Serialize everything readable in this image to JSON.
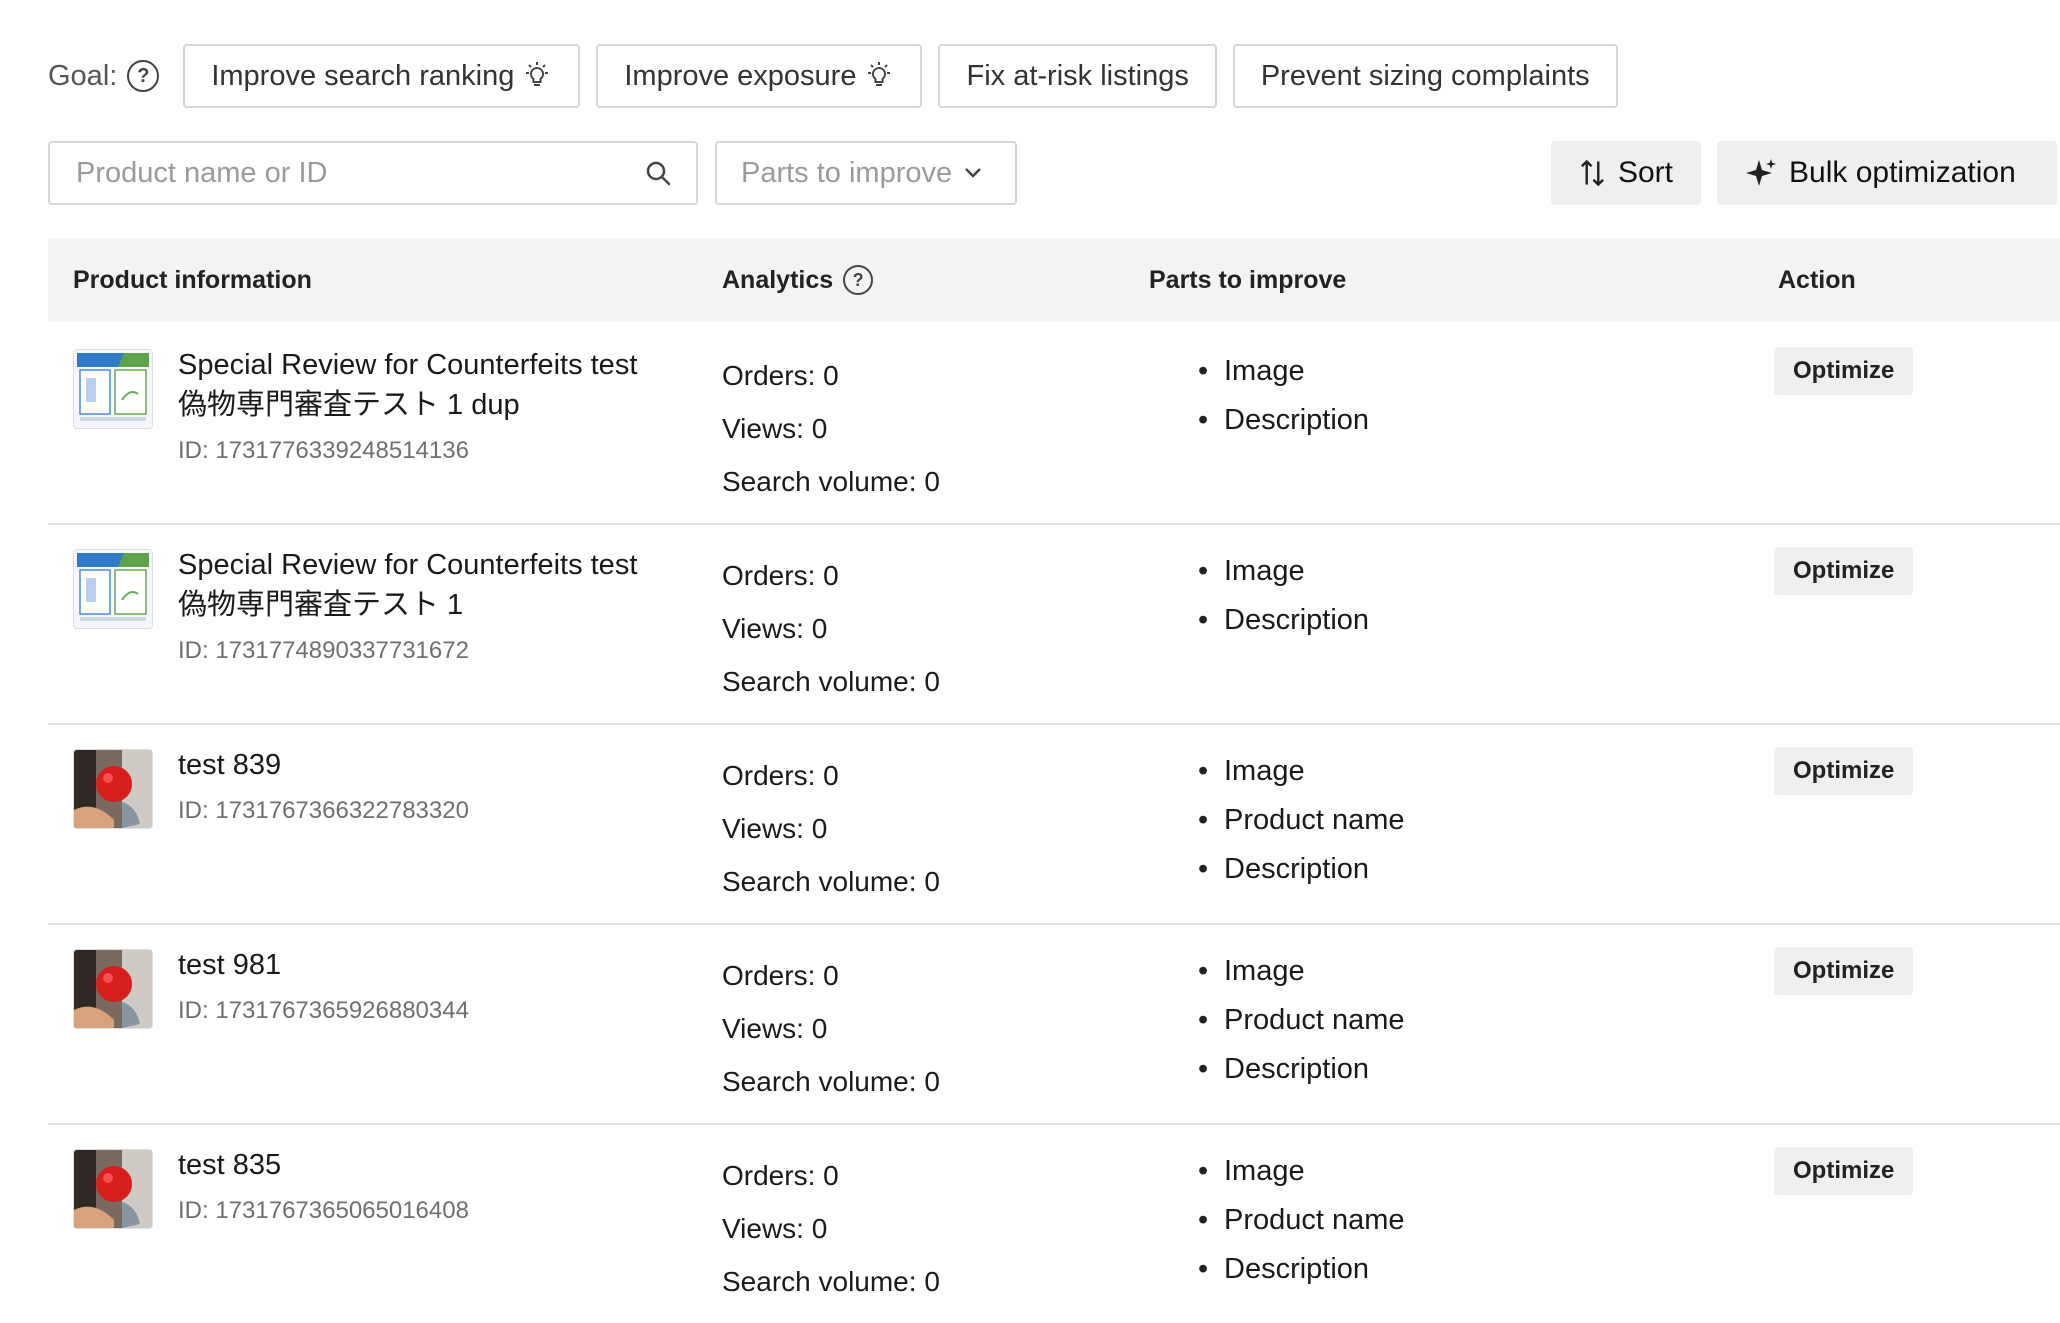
{
  "goal": {
    "label": "Goal:",
    "chips": [
      "Improve search ranking",
      "Improve exposure",
      "Fix at-risk listings",
      "Prevent sizing complaints"
    ]
  },
  "toolbar": {
    "search_placeholder": "Product name or ID",
    "parts_select_placeholder": "Parts to improve",
    "sort_label": "Sort",
    "bulk_label": "Bulk optimization"
  },
  "table": {
    "headers": {
      "product": "Product information",
      "analytics": "Analytics",
      "parts": "Parts to improve",
      "action": "Action"
    },
    "rows": [
      {
        "name_line1": "Special Review for Counterfeits test",
        "name_line2": "偽物専門審査テスト 1 dup",
        "id": "ID: 1731776339248514136",
        "thumb": "poster-icon",
        "orders": "Orders: 0",
        "views": "Views: 0",
        "search_volume": "Search volume: 0",
        "parts": [
          "Image",
          "Description"
        ],
        "action": "Optimize"
      },
      {
        "name_line1": "Special Review for Counterfeits test",
        "name_line2": "偽物専門審査テスト 1",
        "id": "ID: 1731774890337731672",
        "thumb": "poster-icon",
        "orders": "Orders: 0",
        "views": "Views: 0",
        "search_volume": "Search volume: 0",
        "parts": [
          "Image",
          "Description"
        ],
        "action": "Optimize"
      },
      {
        "name_line1": "test 839",
        "name_line2": "",
        "id": "ID: 1731767366322783320",
        "thumb": "apple-photo",
        "orders": "Orders: 0",
        "views": "Views: 0",
        "search_volume": "Search volume: 0",
        "parts": [
          "Image",
          "Product name",
          "Description"
        ],
        "action": "Optimize"
      },
      {
        "name_line1": "test 981",
        "name_line2": "",
        "id": "ID: 1731767365926880344",
        "thumb": "apple-photo",
        "orders": "Orders: 0",
        "views": "Views: 0",
        "search_volume": "Search volume: 0",
        "parts": [
          "Image",
          "Product name",
          "Description"
        ],
        "action": "Optimize"
      },
      {
        "name_line1": "test 835",
        "name_line2": "",
        "id": "ID: 1731767365065016408",
        "thumb": "apple-photo",
        "orders": "Orders: 0",
        "views": "Views: 0",
        "search_volume": "Search volume: 0",
        "parts": [
          "Image",
          "Product name",
          "Description"
        ],
        "action": "Optimize"
      }
    ]
  }
}
